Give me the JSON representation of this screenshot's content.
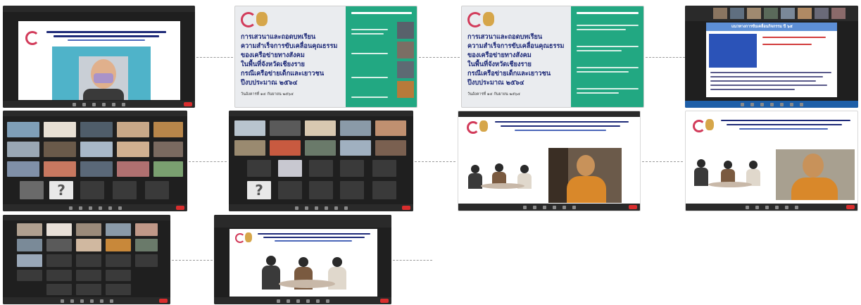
{
  "slide_title_lines": [
    "การเสวนาและถอดบทเรียน",
    "ความสำเร็จการขับเคลื่อนคุณธรรม",
    "ของเครือข่ายทางสังคม",
    "ในพื้นที่จังหวัดเชียงราย",
    "กรณีเครือข่ายเด็กและเยาวชน",
    "ปีงบประมาณ ๒๕๖๔"
  ],
  "slide_date": "วันอังคารที่ ๑๔ กันยายน ๒๕๖๔",
  "slide4_heading": "แนวทางการขับเคลื่อนกิจกรรม ปี ๖๕",
  "unknown_tile_glyph": "?",
  "colors": {
    "zoom_dark": "#1f1f1f",
    "slide_green": "#22a882",
    "title_blue": "#1e2a78",
    "leave_red": "#d92d2d",
    "monk_robe": "#d9882a"
  },
  "screenshots": [
    {
      "id": 1,
      "kind": "zoom-screen-share-presenter"
    },
    {
      "id": 2,
      "kind": "zoom-slide-title"
    },
    {
      "id": 3,
      "kind": "zoom-slide-title"
    },
    {
      "id": 4,
      "kind": "zoom-slide-text"
    },
    {
      "id": 5,
      "kind": "zoom-gallery-view"
    },
    {
      "id": 6,
      "kind": "zoom-gallery-view"
    },
    {
      "id": 7,
      "kind": "zoom-panel-with-monk"
    },
    {
      "id": 8,
      "kind": "zoom-panel-with-monk"
    },
    {
      "id": 9,
      "kind": "zoom-gallery-view"
    },
    {
      "id": 10,
      "kind": "zoom-panel-discussion"
    }
  ]
}
